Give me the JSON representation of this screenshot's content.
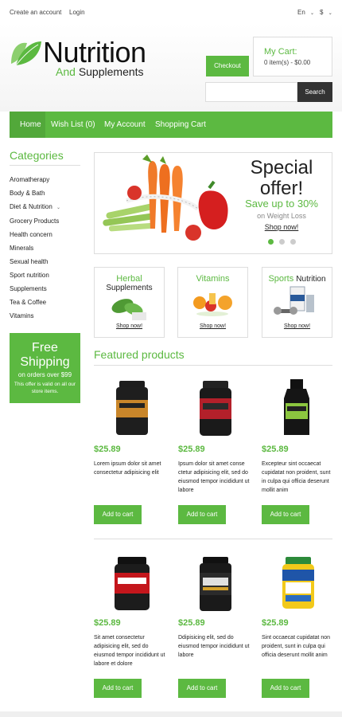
{
  "topbar": {
    "create_account": "Create an account",
    "login": "Login",
    "language": "En",
    "currency": "$"
  },
  "logo": {
    "title": "Nutrition",
    "subtitle_and": "And",
    "subtitle_rest": "Supplements"
  },
  "header": {
    "checkout_label": "Checkout",
    "cart_title": "My Cart:",
    "cart_count": "0 item(s) - $0.00",
    "search_placeholder": "",
    "search_label": "Search"
  },
  "nav": {
    "items": [
      {
        "label": "Home",
        "active": true
      },
      {
        "label": "Wish List (0)"
      },
      {
        "label": "My Account"
      },
      {
        "label": "Shopping Cart"
      }
    ]
  },
  "sidebar": {
    "title": "Categories",
    "items": [
      {
        "label": "Aromatherapy"
      },
      {
        "label": "Body & Bath"
      },
      {
        "label": "Diet & Nutrition"
      },
      {
        "label": "Grocery Products"
      },
      {
        "label": "Health concern"
      },
      {
        "label": "Minerals"
      },
      {
        "label": "Sexual health"
      },
      {
        "label": "Sport nutrition"
      },
      {
        "label": "Supplements"
      },
      {
        "label": "Tea & Coffee"
      },
      {
        "label": "Vitamins"
      }
    ],
    "free_shipping": {
      "line1": "Free",
      "line2": "Shipping",
      "line3": "on orders over $99",
      "line4": "This offer is valid on all our store items."
    }
  },
  "banner": {
    "line1": "Special",
    "line2": "offer!",
    "line3": "Save up to 30%",
    "line4": "on Weight Loss",
    "link": "Shop now!",
    "active_slide": 1,
    "slides": 3
  },
  "category_boxes": [
    {
      "title_green": "Herbal",
      "title_dark": "Supplements",
      "link": "Shop now!"
    },
    {
      "title_green": "Vitamins",
      "title_dark": "",
      "link": "Shop now!"
    },
    {
      "title_green": "Sports",
      "title_dark": "Nutrition",
      "link": "Shop now!"
    }
  ],
  "featured": {
    "title": "Featured products",
    "add_label": "Add to cart",
    "products": [
      {
        "price": "$25.89",
        "desc": "Lorem ipsum dolor sit amet consectetur adipisicing elit"
      },
      {
        "price": "$25.89",
        "desc": "Ipsum dolor sit amet conse ctetur adipisicing elit, sed do eiusmod tempor incididunt ut labore"
      },
      {
        "price": "$25.89",
        "desc": "Excepteur sint occaecat cupidatat non proident, sunt in culpa qui officia deserunt mollit anim"
      },
      {
        "price": "$25.89",
        "desc": "Sit amet consectetur adipisicing elit, sed do eiusmod tempor incididunt ut labore et dolore"
      },
      {
        "price": "$25.89",
        "desc": "Ddipisicing elit, sed do eiusmod tempor incididunt ut labore"
      },
      {
        "price": "$25.89",
        "desc": "Sint occaecat cupidatat non proident, sunt in culpa qui officia deserunt mollit anim"
      }
    ]
  },
  "colors": {
    "accent": "#5cb941",
    "dark_button": "#333333"
  }
}
